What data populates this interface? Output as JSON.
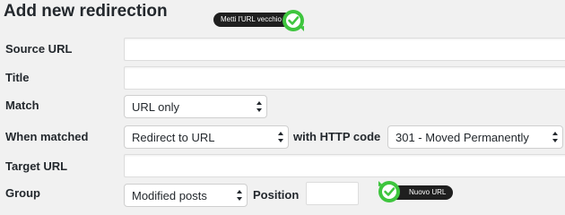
{
  "form": {
    "heading": "Add new redirection",
    "labels": {
      "source_url": "Source URL",
      "title": "Title",
      "match": "Match",
      "when_matched": "When matched",
      "target_url": "Target URL",
      "group": "Group"
    },
    "match_select": "URL only",
    "action_select": "Redirect to URL",
    "http_code_label": "with HTTP code",
    "http_code_select": "301 - Moved Permanently",
    "group_select": "Modified posts",
    "position_label": "Position"
  },
  "annotations": {
    "old_url_tooltip": "Metti l'URL vecchio",
    "new_url_tooltip": "Nuovo URL"
  },
  "colors": {
    "badge_green": "#3ec53e",
    "badge_ring": "#1f1f1f",
    "tooltip_bg": "#1f1f1f"
  }
}
